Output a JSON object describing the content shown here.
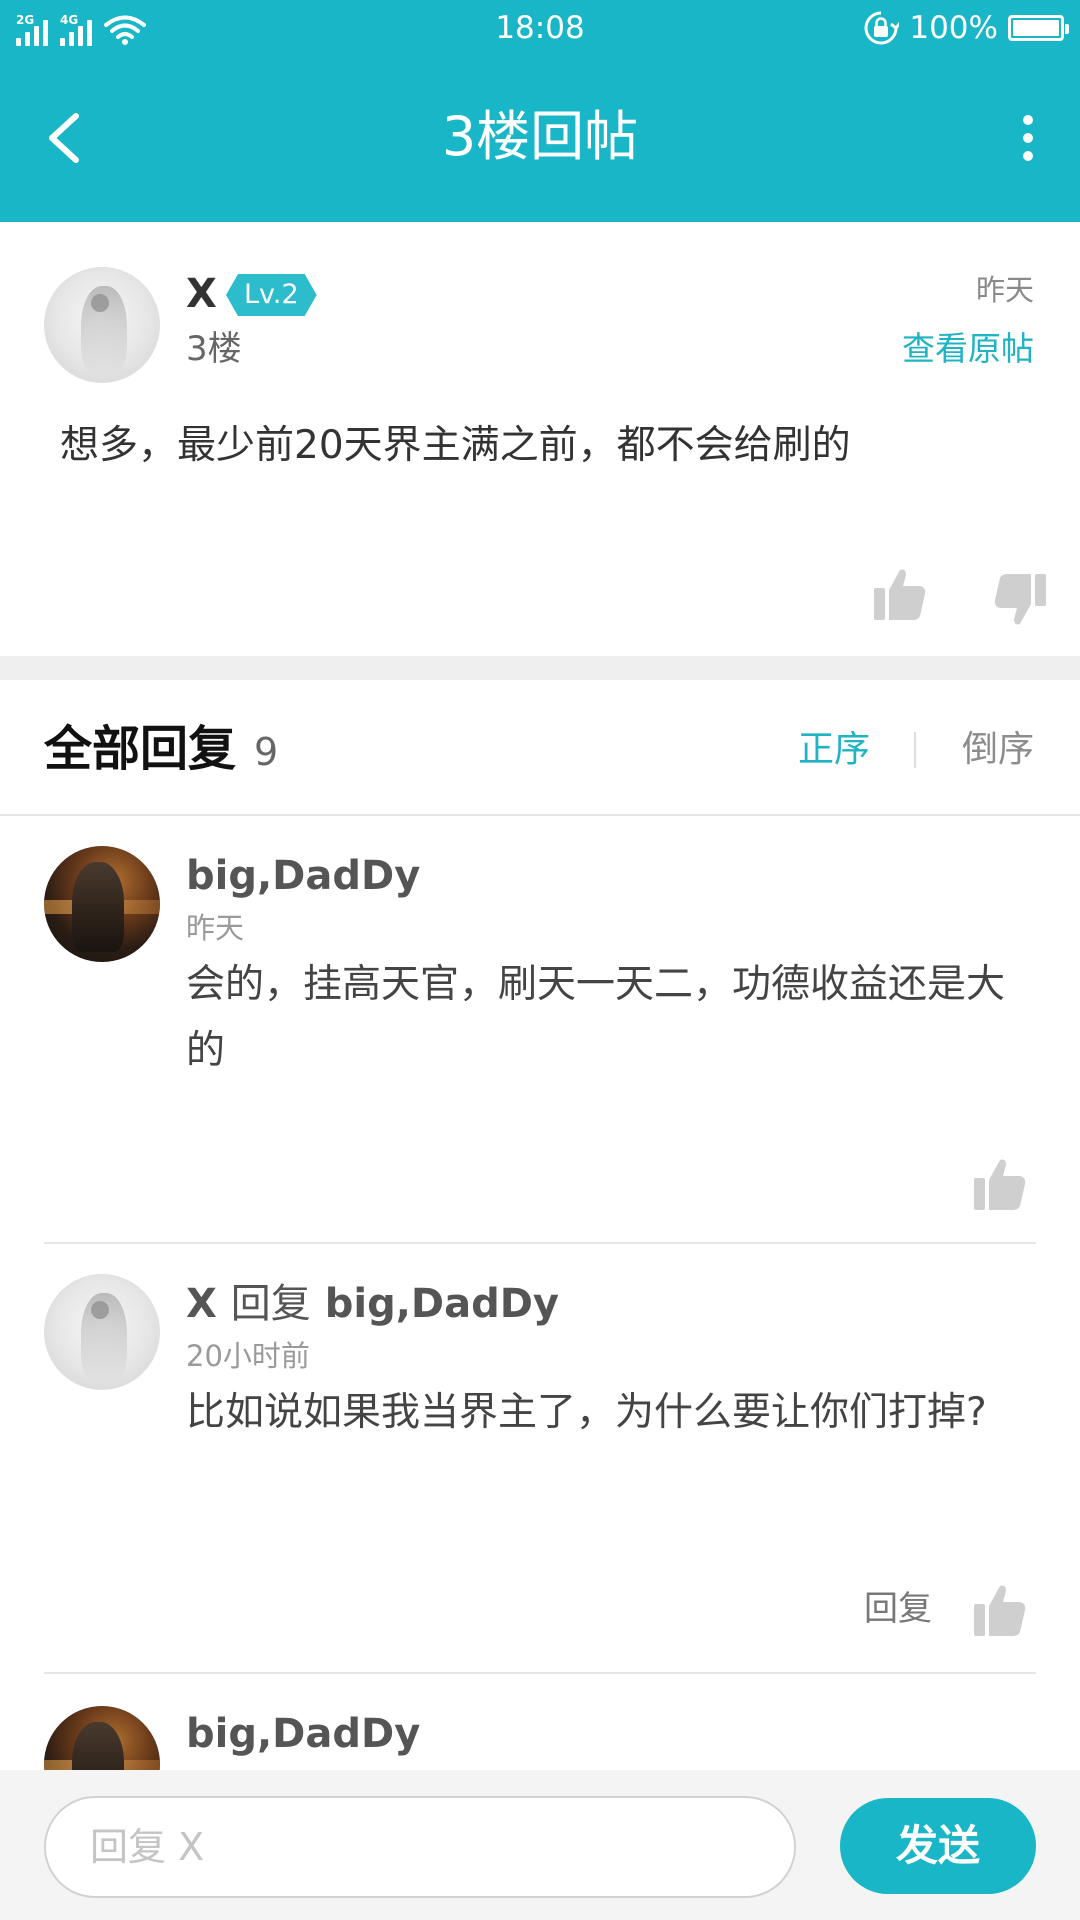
{
  "status_bar": {
    "network_left": "2G",
    "network_right": "4G",
    "time": "18:08",
    "battery": "100%",
    "battery_level": 1.0
  },
  "header": {
    "title": "3楼回帖",
    "back_icon": "chevron-left-icon",
    "more_icon": "more-vertical-icon"
  },
  "post": {
    "author": "X",
    "level": "Lv.2",
    "floor": "3楼",
    "time": "昨天",
    "view_original": "查看原帖",
    "content": "想多，最少前20天界主满之前，都不会给刷的"
  },
  "replies_header": {
    "title": "全部回复",
    "count": "9",
    "sort_asc": "正序",
    "sort_desc": "倒序"
  },
  "replies": [
    {
      "author": "big,DadDy",
      "time": "昨天",
      "content": "会的，挂高天官，刷天一天二，功德收益还是大的"
    },
    {
      "author": "X",
      "verb": "回复",
      "target": "big,DadDy",
      "time": "20小时前",
      "content": "比如说如果我当界主了，为什么要让你们打掉?",
      "reply_label": "回复"
    },
    {
      "author": "big,DadDy"
    }
  ],
  "bottom_bar": {
    "placeholder": "回复 X",
    "send_label": "发送"
  },
  "colors": {
    "accent": "#18b6c6",
    "link": "#1fb3c3",
    "icon_gray": "#cfcfcf"
  }
}
